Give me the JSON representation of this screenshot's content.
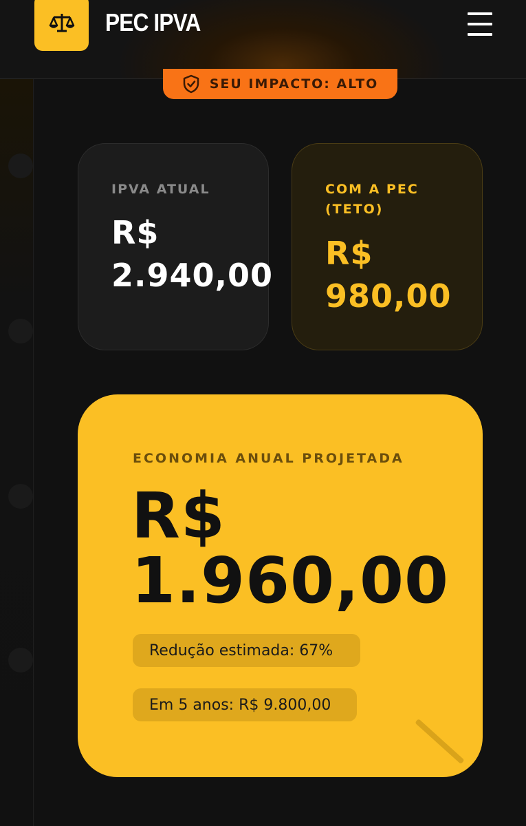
{
  "header": {
    "app_title": "PEC IPVA",
    "logo_icon": "scales-icon",
    "menu_icon": "hamburger-menu-icon"
  },
  "impact": {
    "icon": "shield-check-icon",
    "text": "SEU IMPACTO: ALTO"
  },
  "cards": {
    "current": {
      "label": "IPVA ATUAL",
      "value": "R$ 2.940,00"
    },
    "pec": {
      "label": "COM A PEC (TETO)",
      "value": "R$ 980,00"
    }
  },
  "savings": {
    "label": "ECONOMIA ANUAL PROJETADA",
    "value": "R$ 1.960,00",
    "reduction": "Redução estimada: 67%",
    "five_years": "Em 5 anos: R$ 9.800,00"
  },
  "colors": {
    "background": "#111111",
    "accent": "#fbbf24",
    "impact_orange": "#f97316",
    "card_dark": "#1c1c1c"
  }
}
